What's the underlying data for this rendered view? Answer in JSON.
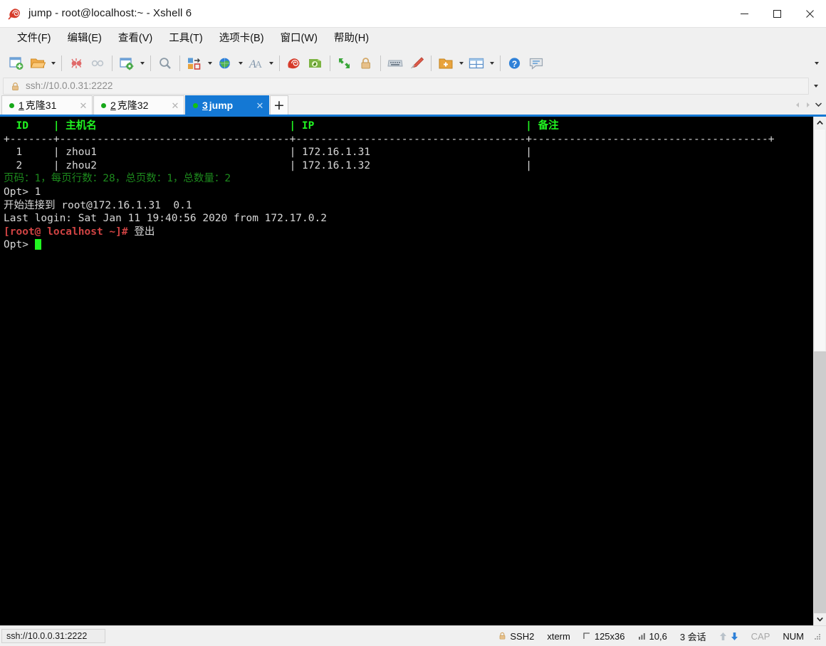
{
  "window": {
    "title": "jump - root@localhost:~ - Xshell 6",
    "icon": "xshell-snail-icon",
    "controls": [
      {
        "name": "minimize-button",
        "glyph": "—"
      },
      {
        "name": "maximize-button",
        "glyph": "□"
      },
      {
        "name": "close-button",
        "glyph": "✕"
      }
    ]
  },
  "menubar": {
    "items": [
      {
        "label": "文件(F)",
        "name": "menu-file"
      },
      {
        "label": "编辑(E)",
        "name": "menu-edit"
      },
      {
        "label": "查看(V)",
        "name": "menu-view"
      },
      {
        "label": "工具(T)",
        "name": "menu-tools"
      },
      {
        "label": "选项卡(B)",
        "name": "menu-tabs"
      },
      {
        "label": "窗口(W)",
        "name": "menu-window"
      },
      {
        "label": "帮助(H)",
        "name": "menu-help"
      }
    ]
  },
  "toolbar": {
    "buttons": [
      "new-session-icon",
      "open-folder-icon",
      "folder-dropdown-caret",
      "separator",
      "disconnect-icon",
      "connect-link-icon",
      "separator",
      "session-properties-icon",
      "properties-dropdown-caret",
      "separator",
      "find-icon",
      "separator",
      "transfer-file-icon",
      "transfer-dropdown-caret",
      "globe-icon",
      "globe-dropdown-caret",
      "font-icon",
      "font-dropdown-caret",
      "separator",
      "xshell-snail-icon",
      "xftp-icon",
      "separator",
      "fullscreen-icon",
      "lock-icon",
      "separator",
      "keyboard-icon",
      "highlight-pen-icon",
      "separator",
      "folder-add-icon",
      "folder-add-dropdown-caret",
      "layout-grid-icon",
      "layout-dropdown-caret",
      "separator",
      "help-icon",
      "chat-icon"
    ],
    "overflow": "toolbar-overflow-caret"
  },
  "addressbar": {
    "icon": "lock-icon",
    "value": "ssh://10.0.0.31:2222",
    "dropdown": "address-dropdown-caret"
  },
  "tabs": {
    "items": [
      {
        "number": "1",
        "label": "克隆31",
        "active": false,
        "status": "connected"
      },
      {
        "number": "2",
        "label": "克隆32",
        "active": false,
        "status": "connected"
      },
      {
        "number": "3",
        "label": "jump",
        "active": true,
        "status": "connected"
      }
    ],
    "add_label": "+",
    "close_glyph": "✕",
    "nav": [
      "tab-scroll-left",
      "tab-scroll-right",
      "tab-list-dropdown"
    ]
  },
  "terminal": {
    "lines": [
      {
        "segments": [
          {
            "text": "  ID    | 主机名                               | IP                                  | 备注",
            "style": "green-bold"
          }
        ]
      },
      {
        "segments": [
          {
            "text": "+-------+-------------------------------------+-------------------------------------+--------------------------------------+",
            "style": "white"
          }
        ]
      },
      {
        "segments": [
          {
            "text": "  1     | zhou1                               | 172.16.1.31                         |",
            "style": "white"
          }
        ]
      },
      {
        "segments": [
          {
            "text": "  2     | zhou2                               | 172.16.1.32                         |",
            "style": "white"
          }
        ]
      },
      {
        "segments": [
          {
            "text": "页码：1，每页行数：28，总页数：1，总数量：2",
            "style": "dim-green"
          }
        ]
      },
      {
        "segments": [
          {
            "text": "Opt> 1",
            "style": "white"
          }
        ]
      },
      {
        "segments": [
          {
            "text": "开始连接到 root@172.16.1.31  0.1",
            "style": "white"
          }
        ]
      },
      {
        "segments": [
          {
            "text": "Last login: Sat Jan 11 19:40:56 2020 from 172.17.0.2",
            "style": "white"
          }
        ]
      },
      {
        "segments": [
          {
            "text": "[root@ localhost ~]#",
            "style": "red-bold"
          },
          {
            "text": " 登出",
            "style": "white"
          }
        ]
      },
      {
        "segments": [
          {
            "text": "Opt> ",
            "style": "white"
          },
          {
            "text": "",
            "style": "cursor"
          }
        ]
      }
    ],
    "colors": {
      "background": "#000000",
      "foreground": "#d8d8d8",
      "green_bold": "#21f521",
      "dim_green": "#1d8a1d",
      "red_bold": "#d04343",
      "cursor": "#21f521"
    }
  },
  "statusbar": {
    "connection": "ssh://10.0.0.31:2222",
    "protocol": "SSH2",
    "terminal_type": "xterm",
    "size": "125x36",
    "cursor_pos": "10,6",
    "sessions": "3 会话",
    "cap": "CAP",
    "num": "NUM",
    "icons": [
      "lock-icon",
      "screen-size-icon",
      "cursor-position-icon",
      "upload-arrow-icon",
      "download-arrow-icon",
      "resize-grip-icon"
    ]
  }
}
